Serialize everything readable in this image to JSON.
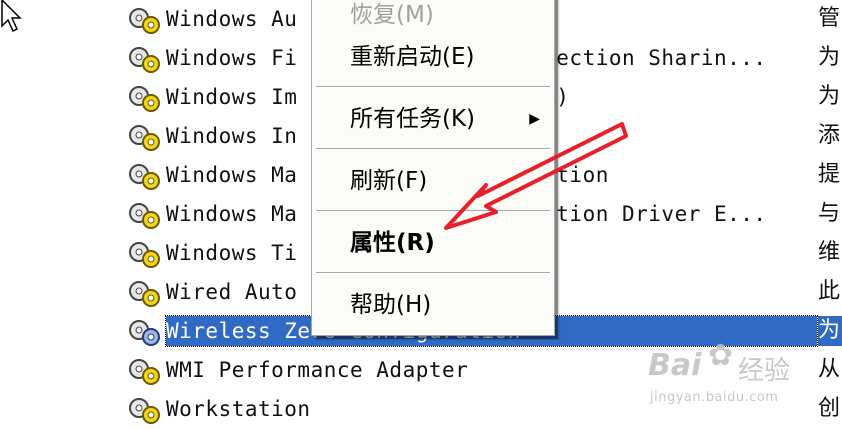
{
  "services": [
    {
      "name": "Windows Au",
      "desc": "",
      "extra": "管"
    },
    {
      "name": "Windows Fi",
      "desc": "nnection Sharin...",
      "extra": "为"
    },
    {
      "name": "Windows Im",
      "desc": "IA)",
      "extra": "为"
    },
    {
      "name": "Windows In",
      "desc": "",
      "extra": "添"
    },
    {
      "name": "Windows Ma",
      "desc": "tation",
      "extra": "提"
    },
    {
      "name": "Windows Ma",
      "desc": "tation Driver E...",
      "extra": "与"
    },
    {
      "name": "Windows Ti",
      "desc": "",
      "extra": "维"
    },
    {
      "name": "Wired Auto",
      "desc": "",
      "extra": "此"
    },
    {
      "name": "Wireless Zero Configuration",
      "desc": "",
      "extra": "为"
    },
    {
      "name": "WMI Performance Adapter",
      "desc": "",
      "extra": "从"
    },
    {
      "name": "Workstation",
      "desc": "",
      "extra": "创"
    }
  ],
  "context_menu": {
    "restore": "恢复(M)",
    "restart": "重新启动(E)",
    "all_tasks": "所有任务(K)",
    "refresh": "刷新(F)",
    "properties": "属性(R)",
    "help": "帮助(H)"
  },
  "watermark": {
    "brand": "Bai",
    "brand_cn": "经验",
    "url": "jingyan.baidu.com"
  },
  "colors": {
    "selection": "#316ac5",
    "annotation_arrow": "#e8202a"
  }
}
